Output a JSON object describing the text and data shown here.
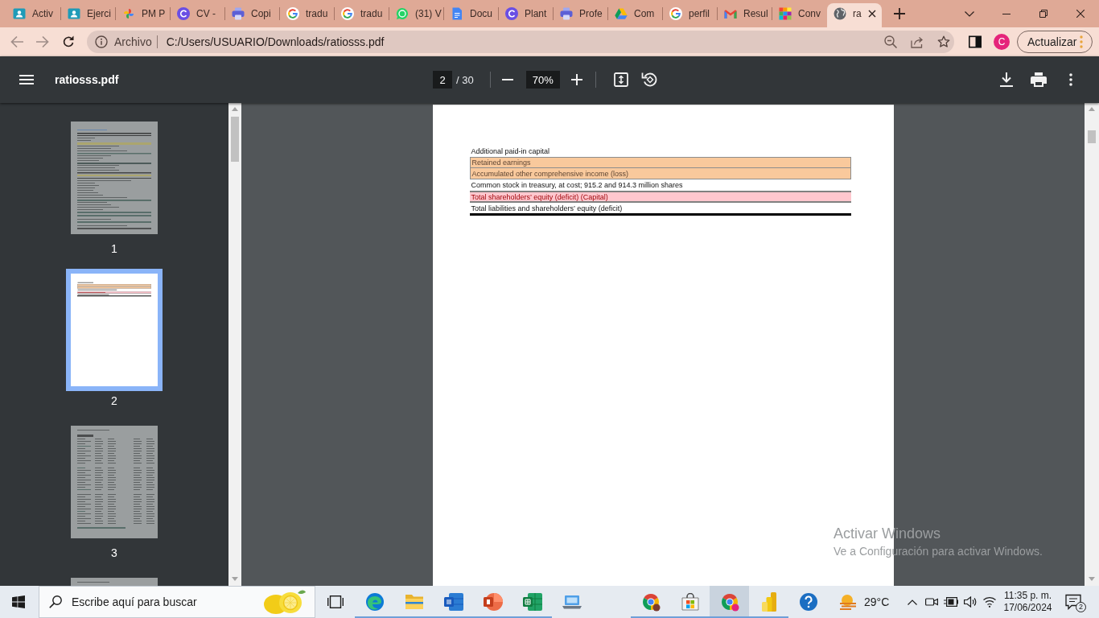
{
  "browser": {
    "tabs": [
      {
        "title": "Activ",
        "kind": "classroom",
        "selected": false
      },
      {
        "title": "Ejerci",
        "kind": "classroom",
        "selected": false
      },
      {
        "title": "PM P",
        "kind": "photos",
        "selected": false
      },
      {
        "title": "CV -",
        "kind": "canva",
        "selected": false
      },
      {
        "title": "Copi",
        "kind": "printer",
        "selected": false
      },
      {
        "title": "tradu",
        "kind": "google",
        "selected": false
      },
      {
        "title": "tradu",
        "kind": "google",
        "selected": false
      },
      {
        "title": "(31) V",
        "kind": "whatsapp",
        "selected": false
      },
      {
        "title": "Docu",
        "kind": "docs",
        "selected": false
      },
      {
        "title": "Plant",
        "kind": "canva",
        "selected": false
      },
      {
        "title": "Profe",
        "kind": "printer",
        "selected": false
      },
      {
        "title": "Com",
        "kind": "drive",
        "selected": false
      },
      {
        "title": "perfil",
        "kind": "google",
        "selected": false
      },
      {
        "title": "Resul",
        "kind": "gmail",
        "selected": false
      },
      {
        "title": "Conv",
        "kind": "grid",
        "selected": false
      },
      {
        "title": "ra",
        "kind": "globe",
        "selected": true
      }
    ],
    "address_bar": {
      "security_label": "Archivo",
      "url": "C:/Users/USUARIO/Downloads/ratiosss.pdf"
    },
    "profile_initial": "C",
    "update_button": "Actualizar"
  },
  "pdf_toolbar": {
    "file_name": "ratiosss.pdf",
    "page_number": "2",
    "page_count": "/ 30",
    "zoom": "70%"
  },
  "thumbnails": [
    {
      "label": "1",
      "kind": "list",
      "selected": false
    },
    {
      "label": "2",
      "kind": "rows",
      "selected": true
    },
    {
      "label": "3",
      "kind": "table",
      "selected": false
    },
    {
      "kind": "table",
      "selected": false
    }
  ],
  "page": {
    "rows": [
      {
        "text": "Additional paid-in capital",
        "kind": "plain"
      },
      {
        "text": "Retained earnings",
        "kind": "highlight"
      },
      {
        "text": "Accumulated other comprehensive income (loss)",
        "kind": "highlight"
      },
      {
        "text": "Common stock in treasury, at cost; 915.2 and 914.3 million shares",
        "kind": "plain"
      },
      {
        "text": "Total shareholders’ equity (deficit) (Capital)",
        "kind": "alert"
      },
      {
        "text": "Total liabilities and shareholders’ equity (deficit)",
        "kind": "total"
      }
    ]
  },
  "activation_notice": {
    "title": "Activar Windows",
    "text": "Ve a Configuración para activar Windows."
  },
  "taskbar": {
    "search_placeholder": "Escribe aquí para buscar",
    "apps": [
      {
        "kind": "task-view",
        "running": false,
        "selected": false
      },
      {
        "kind": "edge",
        "running": true,
        "selected": false
      },
      {
        "kind": "explorer",
        "running": true,
        "selected": false
      },
      {
        "kind": "word",
        "running": true,
        "selected": false
      },
      {
        "kind": "powerpoint",
        "running": true,
        "selected": false
      },
      {
        "kind": "excel",
        "running": true,
        "selected": false
      },
      {
        "kind": "laptop",
        "running": false,
        "selected": false
      },
      {
        "kind": "chrome",
        "running": true,
        "selected": false
      },
      {
        "kind": "store",
        "running": true,
        "selected": false
      },
      {
        "kind": "chrome-profile",
        "running": true,
        "selected": true
      },
      {
        "kind": "powerbi",
        "running": true,
        "selected": false
      },
      {
        "kind": "help",
        "running": false,
        "selected": false
      }
    ],
    "weather": "29°C",
    "time": "11:35 p. m.",
    "date": "17/06/2024",
    "notification_count": "2"
  }
}
